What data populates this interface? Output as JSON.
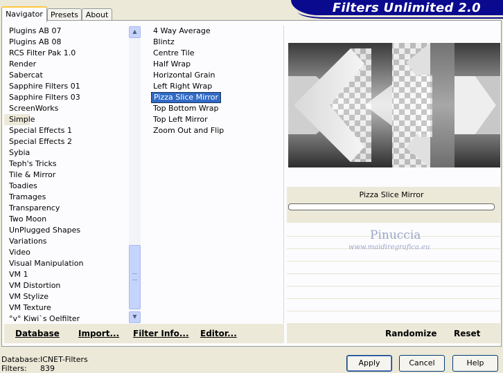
{
  "tabs": [
    {
      "label": "Navigator",
      "active": true
    },
    {
      "label": "Presets",
      "active": false
    },
    {
      "label": "About",
      "active": false
    }
  ],
  "banner_title": "Filters Unlimited 2.0",
  "categories": [
    "Plugins AB 07",
    "Plugins AB 08",
    "RCS Filter Pak 1.0",
    "Render",
    "Sabercat",
    "Sapphire Filters 01",
    "Sapphire Filters 03",
    "ScreenWorks",
    "Simple",
    "Special Effects 1",
    "Special Effects 2",
    "Sybia",
    "Teph's Tricks",
    "Tile & Mirror",
    "Toadies",
    "Tramages",
    "Transparency",
    "Two Moon",
    "UnPlugged Shapes",
    "Variations",
    "Video",
    "Visual Manipulation",
    "VM 1",
    "VM Distortion",
    "VM Stylize",
    "VM Texture",
    "°v° Kiwi`s Oelfilter"
  ],
  "selected_category": "Simple",
  "filters": [
    "4 Way Average",
    "Blintz",
    "Centre Tile",
    "Half Wrap",
    "Horizontal Grain",
    "Left Right Wrap",
    "Pizza Slice Mirror",
    "Top Bottom Wrap",
    "Top Left Mirror",
    "Zoom Out and Flip"
  ],
  "selected_filter": "Pizza Slice Mirror",
  "preview_filter_name": "Pizza Slice Mirror",
  "watermark": {
    "line1": "Pinuccia",
    "line2": "www.maidiregrafica.eu"
  },
  "toolbar": {
    "database": "Database",
    "import": "Import...",
    "filter_info": "Filter Info...",
    "editor": "Editor...",
    "randomize": "Randomize",
    "reset": "Reset"
  },
  "status": {
    "database_label": "Database:",
    "database_value": "ICNET-Filters",
    "filters_label": "Filters:",
    "filters_value": "839"
  },
  "buttons": {
    "apply": "Apply",
    "cancel": "Cancel",
    "help": "Help"
  },
  "colors": {
    "banner": "#0a0a8f",
    "selection": "#316ac5",
    "face": "#ece9d8"
  }
}
